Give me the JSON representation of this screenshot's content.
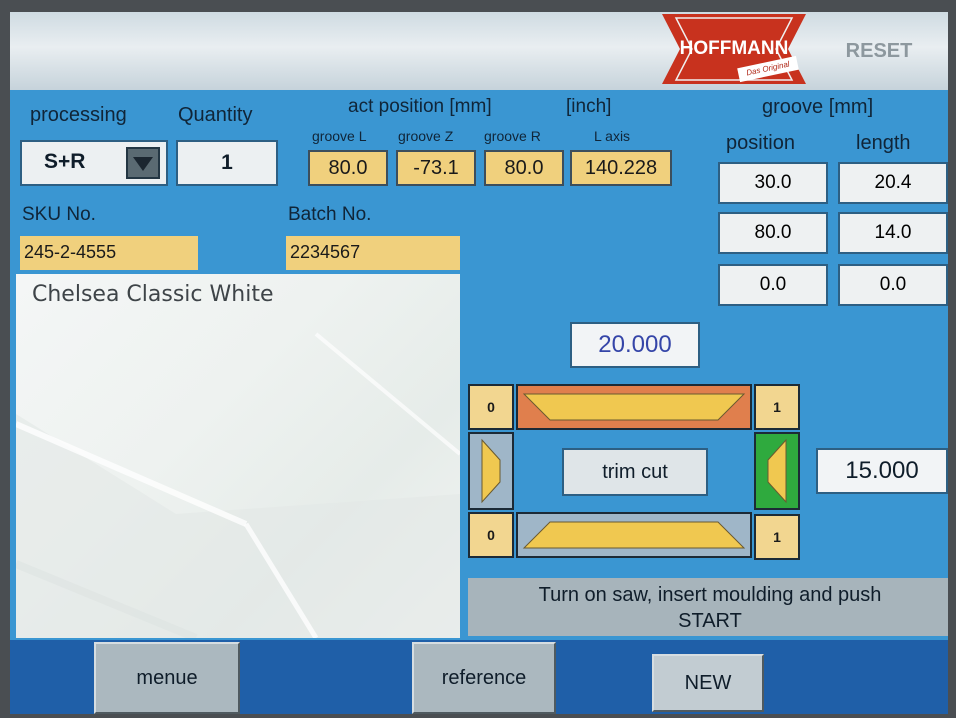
{
  "header": {
    "logo_text": "HOFFMANN",
    "logo_tagline": "Das Original",
    "reset_label": "RESET"
  },
  "labels": {
    "processing": "processing",
    "quantity": "Quantity",
    "act_position": "act position [mm]",
    "inch": "[inch]",
    "groove_l": "groove L",
    "groove_z": "groove Z",
    "groove_r": "groove R",
    "l_axis": "L axis",
    "groove_mm": "groove [mm]",
    "position": "position",
    "length": "length",
    "sku": "SKU No.",
    "batch": "Batch No."
  },
  "processing_value": "S+R",
  "quantity_value": "1",
  "positions": {
    "groove_l": "80.0",
    "groove_z": "-73.1",
    "groove_r": "80.0",
    "l_axis": "140.228"
  },
  "grooves": [
    {
      "position": "30.0",
      "length": "20.4"
    },
    {
      "position": "80.0",
      "length": "14.0"
    },
    {
      "position": "0.0",
      "length": "0.0"
    }
  ],
  "sku_value": "245-2-4555",
  "batch_value": "2234567",
  "product_name": "Chelsea Classic White",
  "trim": {
    "width_value": "20.000",
    "side_value": "15.000",
    "top_left": "0",
    "top_right": "1",
    "bottom_left": "0",
    "bottom_right": "1",
    "trim_label": "trim cut"
  },
  "message": {
    "line1": "Turn on saw, insert moulding and push",
    "line2": "START"
  },
  "footer": {
    "menue": "menue",
    "reference": "reference",
    "new": "NEW"
  },
  "colors": {
    "panel_blue": "#3a96d2",
    "field_yellow": "#f0d07d",
    "bar_orange": "#e07f4d",
    "bar_green": "#2faa3e",
    "footer_blue": "#1f5fa8"
  }
}
